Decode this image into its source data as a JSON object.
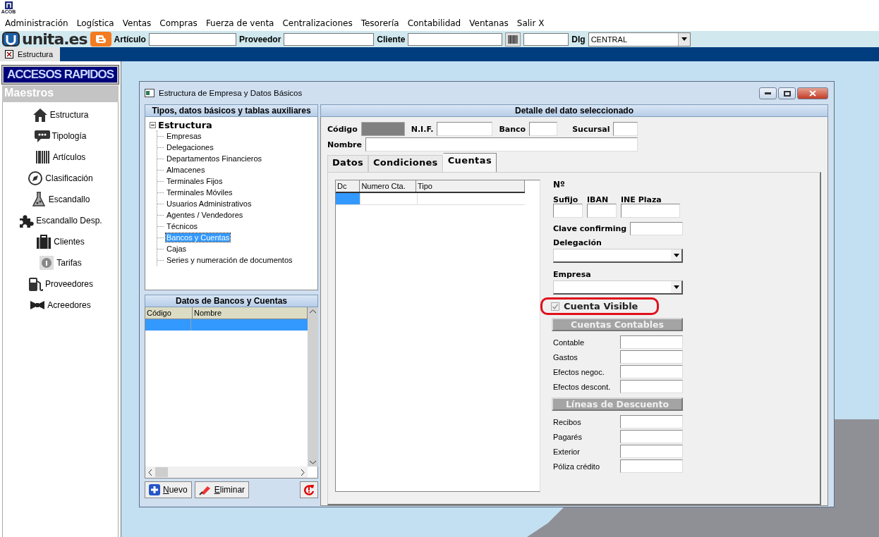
{
  "app": {
    "logo_text": "ACOB"
  },
  "menu": [
    "Administración",
    "Logística",
    "Ventas",
    "Compras",
    "Fuerza de venta",
    "Centralizaciones",
    "Tesorería",
    "Contabilidad",
    "Ventanas",
    "Salir X"
  ],
  "toolbar": {
    "logo": "unita.es",
    "fields": [
      {
        "label": "Artículo"
      },
      {
        "label": "Proveedor"
      },
      {
        "label": "Cliente"
      }
    ],
    "dlg": {
      "label": "Dlg",
      "value": "CENTRAL"
    }
  },
  "doc_tabs": [
    {
      "label": "Estructura",
      "selected": true
    }
  ],
  "sidebar": {
    "title": "ACCESOS RAPIDOS",
    "section": "Maestros",
    "items": [
      "Estructura",
      "Tipología",
      "Artículos",
      "Clasificación",
      "Escandallo",
      "Escandallo Desp.",
      "Clientes",
      "Tarifas",
      "Proveedores",
      "Acreedores"
    ]
  },
  "window": {
    "title": "Estructura de Empresa y Datos Básicos",
    "tree_panel": {
      "title": "Tipos, datos básicos y tablas auxiliares",
      "root": {
        "label": "Estructura",
        "expanded": true,
        "children": [
          {
            "label": "Empresas",
            "selected": false
          },
          {
            "label": "Delegaciones",
            "selected": false
          },
          {
            "label": "Departamentos Financieros",
            "selected": false
          },
          {
            "label": "Almacenes",
            "selected": false
          },
          {
            "label": "Terminales Fijos",
            "selected": false
          },
          {
            "label": "Terminales Móviles",
            "selected": false
          },
          {
            "label": "Usuarios Administrativos",
            "selected": false
          },
          {
            "label": "Agentes / Vendedores",
            "selected": false
          },
          {
            "label": "Técnicos",
            "selected": false
          },
          {
            "label": "Bancos y Cuentas",
            "selected": true
          },
          {
            "label": "Cajas",
            "selected": false
          },
          {
            "label": "Series y numeración de documentos",
            "selected": false
          }
        ]
      }
    },
    "list_panel": {
      "title": "Datos de Bancos y Cuentas",
      "columns": [
        "Código",
        "Nombre"
      ]
    },
    "buttons": [
      "Nuevo",
      "Eliminar"
    ],
    "detail": {
      "title": "Detalle del dato seleccionado",
      "fields": [
        {
          "label": "Código",
          "kind": "readonly"
        },
        {
          "label": "N.I.F.",
          "kind": "text"
        },
        {
          "label": "Banco",
          "kind": "text"
        },
        {
          "label": "Sucursal",
          "kind": "text"
        }
      ],
      "name_field": {
        "label": "Nombre"
      },
      "tabs": [
        {
          "label": "Datos",
          "selected": false
        },
        {
          "label": "Condiciones",
          "selected": false
        },
        {
          "label": "Cuentas",
          "selected": true
        }
      ],
      "grid": {
        "columns": [
          "Dc",
          "Numero Cta.",
          "Tipo"
        ]
      },
      "number_label": "Nº",
      "small_fields": [
        {
          "label": "Sufijo"
        },
        {
          "label": "IBAN"
        },
        {
          "label": "INE Plaza"
        }
      ],
      "confirming_label": "Clave confirming",
      "dropdowns": [
        {
          "label": "Delegación"
        },
        {
          "label": "Empresa"
        }
      ],
      "checkbox": {
        "label": "Cuenta Visible",
        "checked": true,
        "disabled": true,
        "highlighted": true
      },
      "groups": [
        {
          "title": "Cuentas Contables",
          "rows": [
            "Contable",
            "Gastos",
            "Efectos negoc.",
            "Efectos descont."
          ]
        },
        {
          "title": "Líneas de Descuento",
          "rows": [
            "Recibos",
            "Pagarés",
            "Exterior",
            "Póliza crédito"
          ]
        }
      ]
    }
  }
}
